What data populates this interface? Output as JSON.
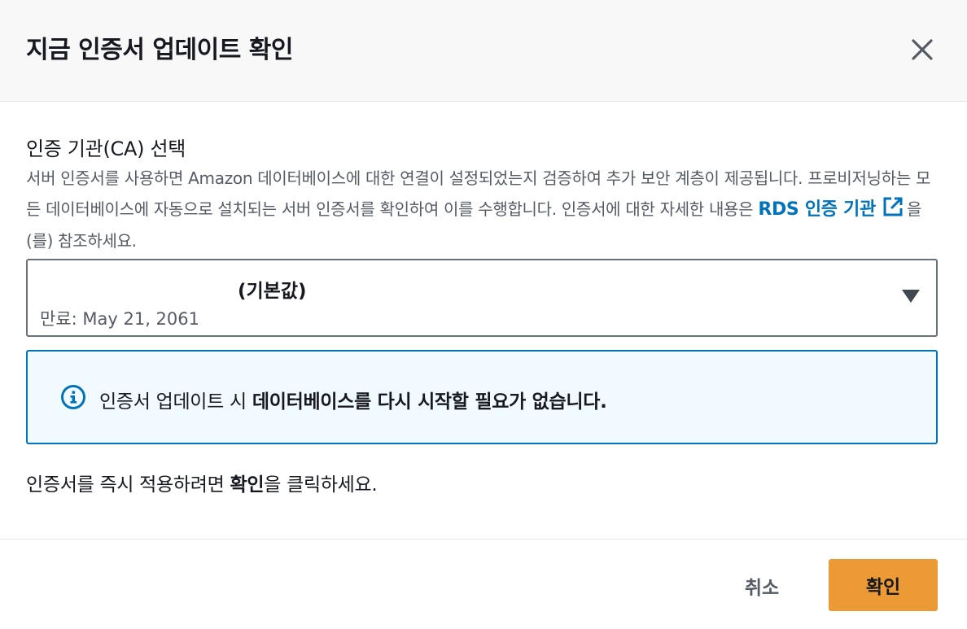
{
  "modal": {
    "title": "지금 인증서 업데이트 확인",
    "close_icon": "close-icon"
  },
  "ca_section": {
    "label": "인증 기관(CA) 선택",
    "description_before_link": "서버 인증서를 사용하면 Amazon 데이터베이스에 대한 연결이 설정되었는지 검증하여 추가 보안 계층이 제공됩니다. 프로비저닝하는 모든 데이터베이스에 자동으로 설치되는 서버 인증서를 확인하여 이를 수행합니다. 인증서에 대한 자세한 내용은 ",
    "link_text": "RDS 인증 기관",
    "link_icon": "external-link-icon",
    "description_after_link": "을(를) 참조하세요."
  },
  "ca_select": {
    "selected_label": "(기본값)",
    "expiry": "만료: May 21, 2061",
    "caret_icon": "caret-down-icon"
  },
  "alert": {
    "icon": "info-icon",
    "text_normal": "인증서 업데이트 시 ",
    "text_bold": "데이터베이스를 다시 시작할 필요가 없습니다."
  },
  "instruction": {
    "before": "인증서를 즉시 적용하려면 ",
    "bold": "확인",
    "after": "을 클릭하세요."
  },
  "footer": {
    "cancel_label": "취소",
    "confirm_label": "확인"
  },
  "colors": {
    "primary_button": "#ec9a35",
    "link": "#0073bb",
    "info_border": "#0073bb",
    "info_background": "#f1faff"
  }
}
